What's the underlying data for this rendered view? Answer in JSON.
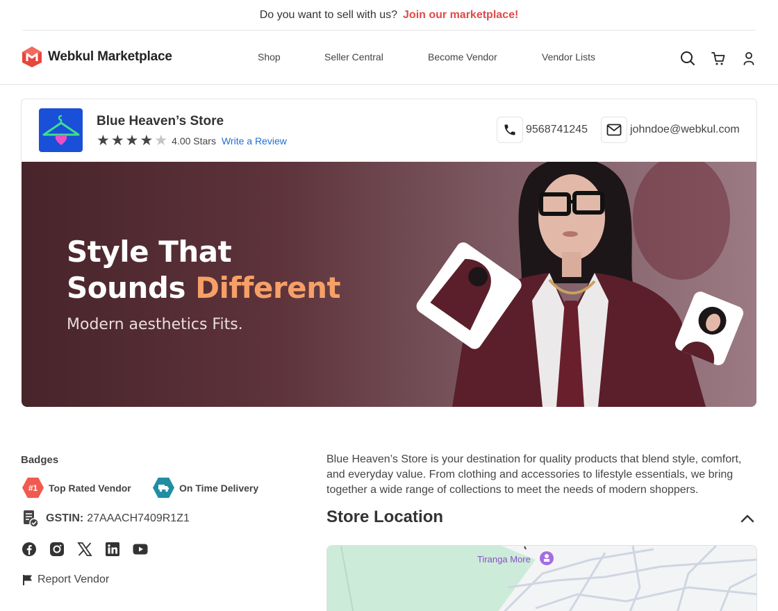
{
  "promo": {
    "text": "Do you want to sell with us?",
    "link": "Join our marketplace!"
  },
  "header": {
    "brand": "Webkul Marketplace",
    "nav": [
      "Shop",
      "Seller Central",
      "Become Vendor",
      "Vendor Lists"
    ],
    "icons": [
      "search-icon",
      "cart-icon",
      "user-icon"
    ]
  },
  "store": {
    "name": "Blue Heaven’s Store",
    "rating_value": 4,
    "rating_max": 5,
    "rating_text": "4.00 Stars",
    "review_link": "Write a Review",
    "phone": "9568741245",
    "email": "johndoe@webkul.com"
  },
  "banner": {
    "line1": "Style That",
    "line2_plain": "Sounds ",
    "line2_accent": "Different",
    "subtitle": "Modern aesthetics Fits.",
    "accent_color": "#f6a067"
  },
  "badges": {
    "title": "Badges",
    "items": [
      {
        "label": "Top Rated Vendor",
        "icon_text": "#1",
        "color": "#f05a4f"
      },
      {
        "label": "On Time Delivery",
        "icon_text": "",
        "color": "#1f8ea3"
      }
    ]
  },
  "gstin": {
    "label": "GSTIN:",
    "value": "27AAACH7409R1Z1"
  },
  "social": [
    "facebook-icon",
    "instagram-icon",
    "x-icon",
    "linkedin-icon",
    "youtube-icon"
  ],
  "report": {
    "label": "Report Vendor"
  },
  "about": {
    "description": "Blue Heaven’s Store is your destination for quality products that blend style, comfort, and everyday value. From clothing and accessories to lifestyle essentials, we bring together a wide range of collections to meet the needs of modern shoppers."
  },
  "location": {
    "title": "Store Location",
    "map_label": "Tiranga More"
  },
  "colors": {
    "brand_red": "#e04a4a",
    "link_blue": "#1d6fd8",
    "store_logo_bg": "#1a4fd8"
  }
}
